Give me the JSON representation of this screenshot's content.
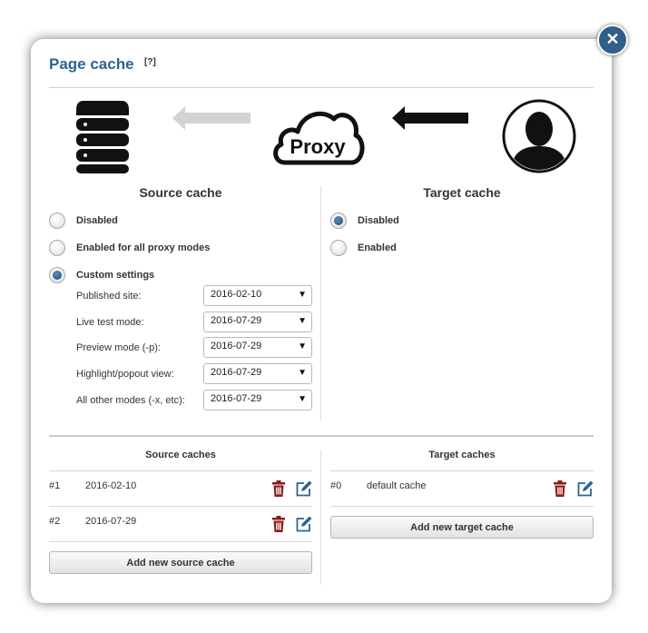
{
  "dialog": {
    "title": "Page cache",
    "help_label": "[?]",
    "close_label": "✕"
  },
  "diagram": {
    "proxy_label": "Proxy"
  },
  "source_cache": {
    "heading": "Source cache",
    "options": [
      {
        "label": "Disabled",
        "checked": false
      },
      {
        "label": "Enabled for all proxy modes",
        "checked": false
      },
      {
        "label": "Custom settings",
        "checked": true
      }
    ],
    "settings": [
      {
        "label": "Published site:",
        "value": "2016-02-10"
      },
      {
        "label": "Live test mode:",
        "value": "2016-07-29"
      },
      {
        "label": "Preview mode (-p):",
        "value": "2016-07-29"
      },
      {
        "label": "Highlight/popout view:",
        "value": "2016-07-29"
      },
      {
        "label": "All other modes (-x, etc):",
        "value": "2016-07-29"
      }
    ]
  },
  "target_cache": {
    "heading": "Target cache",
    "options": [
      {
        "label": "Disabled",
        "checked": true
      },
      {
        "label": "Enabled",
        "checked": false
      }
    ]
  },
  "source_caches": {
    "heading": "Source caches",
    "rows": [
      {
        "num": "#1",
        "name": "2016-02-10"
      },
      {
        "num": "#2",
        "name": "2016-07-29"
      }
    ],
    "add_label": "Add new source cache"
  },
  "target_caches": {
    "heading": "Target caches",
    "rows": [
      {
        "num": "#0",
        "name": "default cache"
      }
    ],
    "add_label": "Add new target cache"
  },
  "icons": [
    "server-icon",
    "arrow-left-icon",
    "proxy-cloud-icon",
    "user-icon",
    "trash-icon",
    "edit-icon",
    "close-icon"
  ],
  "colors": {
    "title": "#2f6290",
    "accent": "#2d5f8c",
    "trash": "#8b1a1a",
    "edit": "#2f6290"
  }
}
